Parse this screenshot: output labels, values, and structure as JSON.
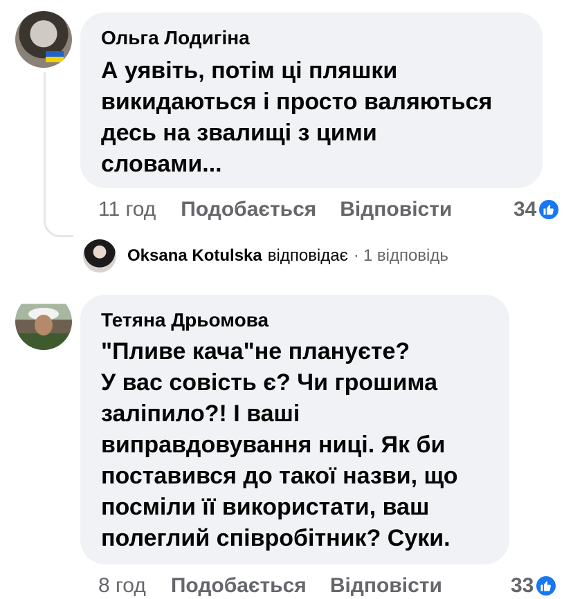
{
  "comments": [
    {
      "author": "Ольга Лодигіна",
      "text": "А уявіть,  потім ці пляшки\nвикидаються і просто валяються\nдесь на звалищі з цими\nсловами...",
      "time": "11 год",
      "like_label": "Подобається",
      "reply_label": "Відповісти",
      "reactions": "34",
      "reply_summary": {
        "name": "Oksana Kotulska",
        "action": "відповідає",
        "separator": "·",
        "count": "1 відповідь"
      }
    },
    {
      "author": "Тетяна Дрьомова",
      "text": "\"Пливе кача\"не плануєте?\nУ вас совість є? Чи грошима\nзаліпило?! І ваші\nвиправдовування ниці. Як би\nпоставився до такої назви, що\nпосміли її використати, ваш\nполеглий співробітник? Суки.",
      "time": "8 год",
      "like_label": "Подобається",
      "reply_label": "Відповісти",
      "reactions": "33"
    }
  ],
  "colors": {
    "bubble": "#f0f2f5",
    "meta": "#65676b",
    "like_blue": "#1877f2"
  },
  "icons": [
    "like-thumb-icon"
  ]
}
